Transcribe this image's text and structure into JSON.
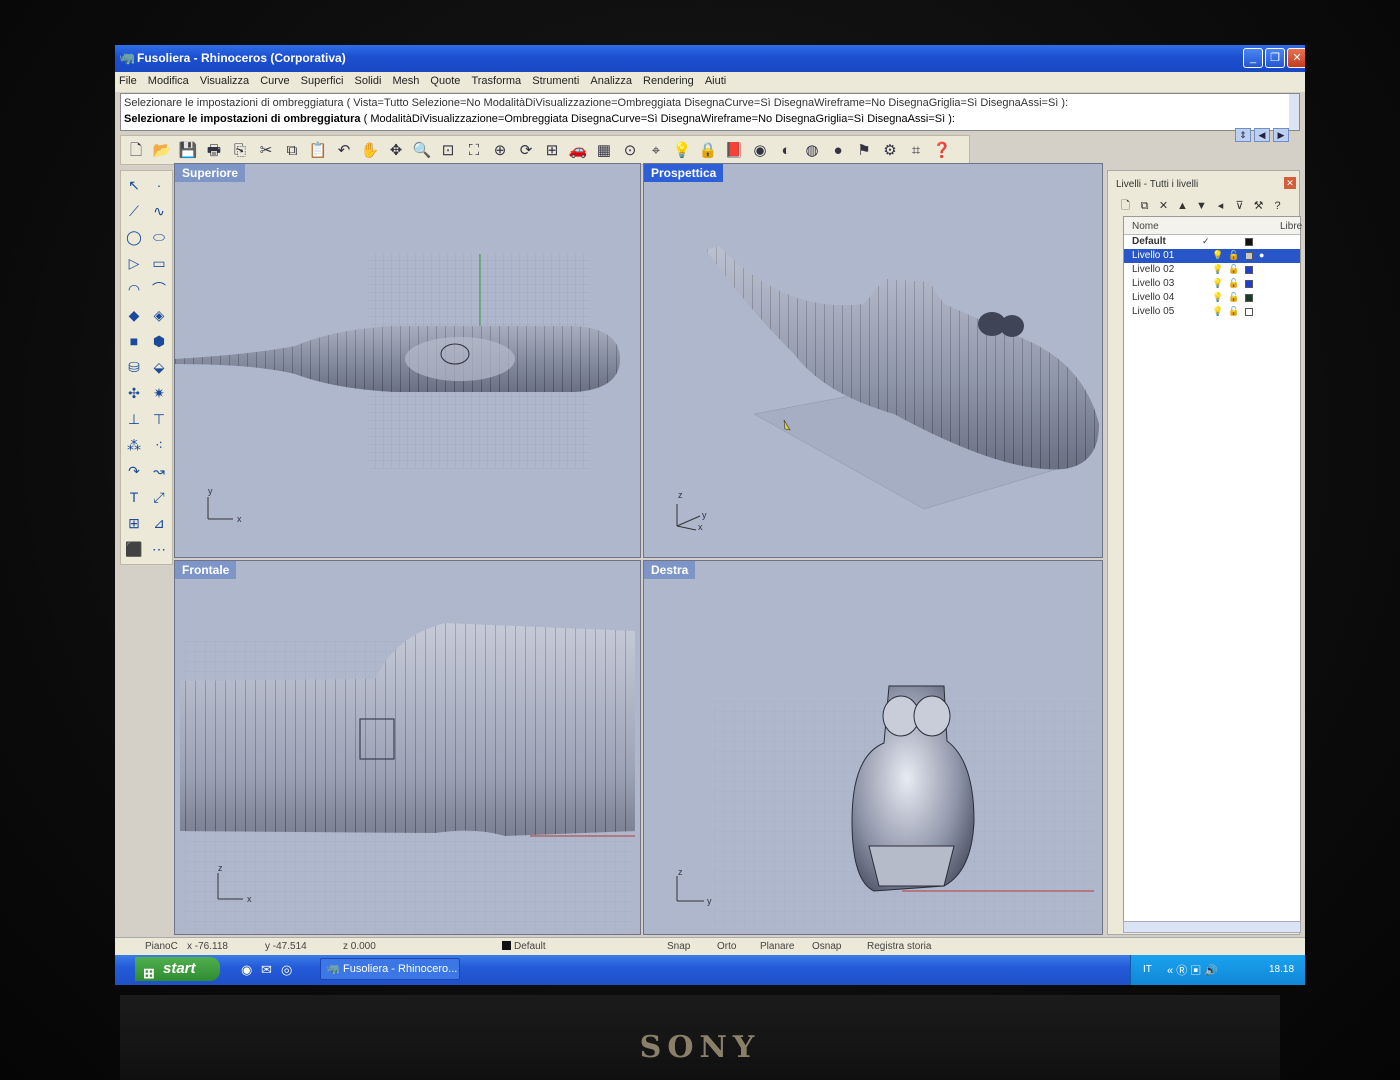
{
  "window": {
    "title": "Fusoliera - Rhinoceros (Corporativa)",
    "controls": {
      "minimize": "_",
      "maximize": "❐",
      "close": "✕"
    }
  },
  "menu": [
    "File",
    "Modifica",
    "Visualizza",
    "Curve",
    "Superfici",
    "Solidi",
    "Mesh",
    "Quote",
    "Trasforma",
    "Strumenti",
    "Analizza",
    "Rendering",
    "Aiuti"
  ],
  "command": {
    "history": "Selezionare le impostazioni di ombreggiatura ( Vista=Tutto  Selezione=No  ModalitàDiVisualizzazione=Ombreggiata  DisegnaCurve=Sì  DisegnaWireframe=No  DisegnaGriglia=Sì  DisegnaAssi=Sì ):",
    "prompt_bold": "Selezionare le impostazioni di ombreggiatura",
    "prompt_rest": " ( ModalitàDiVisualizzazione=Ombreggiata  DisegnaCurve=Sì  DisegnaWireframe=No  DisegnaGriglia=Sì  DisegnaAssi=Sì ):"
  },
  "viewports": {
    "top": {
      "label": "Superiore",
      "axis1": "y",
      "axis2": "x"
    },
    "perspective": {
      "label": "Prospettica",
      "axis1": "z",
      "axis2": "y",
      "axis3": "x"
    },
    "front": {
      "label": "Frontale",
      "axis1": "z",
      "axis2": "x"
    },
    "right": {
      "label": "Destra",
      "axis1": "z",
      "axis2": "y"
    }
  },
  "layers_panel": {
    "title": "Livelli - Tutti i livelli",
    "col_name": "Nome",
    "col_right": "Libre",
    "rows": [
      {
        "name": "Default",
        "current": "✓",
        "color": "#111111"
      },
      {
        "name": "Livello 01",
        "color": "#c8c8c8"
      },
      {
        "name": "Livello 02",
        "color": "#1f3fd0"
      },
      {
        "name": "Livello 03",
        "color": "#1f3fd0"
      },
      {
        "name": "Livello 04",
        "color": "#1a3a2a"
      },
      {
        "name": "Livello 05",
        "color": "#ffffff"
      }
    ]
  },
  "status": {
    "cplane": "PianoC",
    "x": "x -76.118",
    "y": "y -47.514",
    "z": "z 0.000",
    "layer": "Default",
    "snap": "Snap",
    "orto": "Orto",
    "planare": "Planare",
    "osnap": "Osnap",
    "history": "Registra storia"
  },
  "taskbar": {
    "start": "start",
    "task": "Fusoliera - Rhinocero...",
    "lang": "IT",
    "clock": "18.18"
  },
  "monitor_brand": "SONY"
}
